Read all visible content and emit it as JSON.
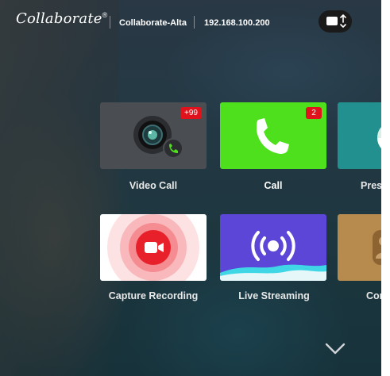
{
  "header": {
    "logo_text": "Collaborate",
    "logo_mark": "®",
    "room_name": "Collaborate-Alta",
    "ip_address": "192.168.100.200",
    "share_icon": "screen-share-icon"
  },
  "tiles": [
    {
      "label": "Video Call",
      "badge": "+99",
      "icon": "webcam-phone-icon",
      "color": "#4a4d52"
    },
    {
      "label": "Call",
      "badge": "2",
      "icon": "phone-handset-icon",
      "color": "#4ee01d"
    },
    {
      "label": "Prese",
      "icon": "pie-chart-icon",
      "color": "#21908f"
    },
    {
      "label": "Capture Recording",
      "icon": "video-camera-icon",
      "color": "#ffffff"
    },
    {
      "label": "Live Streaming",
      "icon": "broadcast-icon",
      "color": "#5b46d7"
    },
    {
      "label": "Cont",
      "icon": "contacts-icon",
      "color": "#b78a4e"
    }
  ],
  "footer": {
    "scroll_icon": "chevron-down-icon"
  },
  "colors": {
    "badge": "#e0121b",
    "record_red": "#e8202a"
  }
}
